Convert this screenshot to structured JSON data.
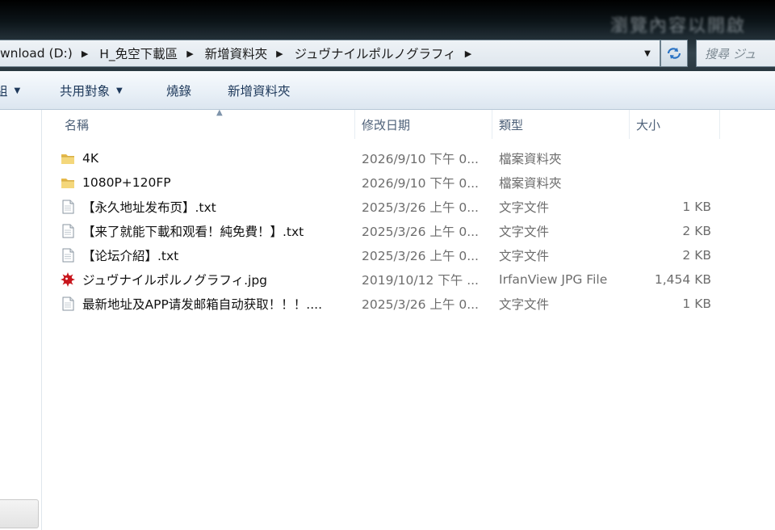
{
  "window": {
    "title_blurred": "瀏覽內容以開啟"
  },
  "address": {
    "crumbs": [
      "wnload (D:)",
      "H_免空下載區",
      "新增資料夾",
      "ジュヴナイルポルノグラフィ"
    ],
    "search_placeholder": "搜尋 ジュ"
  },
  "toolbar": {
    "organize_label": "組",
    "share_label": "共用對象",
    "burn_label": "燒錄",
    "new_folder_label": "新增資料夾"
  },
  "columns": {
    "name": "名稱",
    "date": "修改日期",
    "type": "類型",
    "size": "大小"
  },
  "files": [
    {
      "name": "4K",
      "date": "2026/9/10 下午 0...",
      "type": "檔案資料夾",
      "size": "",
      "icon": "folder-icon"
    },
    {
      "name": "1080P+120FP",
      "date": "2026/9/10 下午 0...",
      "type": "檔案資料夾",
      "size": "",
      "icon": "folder-icon"
    },
    {
      "name": "【永久地址发布页】.txt",
      "date": "2025/3/26 上午 0...",
      "type": "文字文件",
      "size": "1 KB",
      "icon": "text-file-icon"
    },
    {
      "name": "【来了就能下載和观看！純免費！】.txt",
      "date": "2025/3/26 上午 0...",
      "type": "文字文件",
      "size": "2 KB",
      "icon": "text-file-icon"
    },
    {
      "name": "【论坛介紹】.txt",
      "date": "2025/3/26 上午 0...",
      "type": "文字文件",
      "size": "2 KB",
      "icon": "text-file-icon"
    },
    {
      "name": "ジュヴナイルポルノグラフィ.jpg",
      "date": "2019/10/12 下午 ...",
      "type": "IrfanView JPG File",
      "size": "1,454 KB",
      "icon": "irfanview-image-icon"
    },
    {
      "name": "最新地址及APP请发邮箱自动获取！！！....",
      "date": "2025/3/26 上午 0...",
      "type": "文字文件",
      "size": "1 KB",
      "icon": "text-file-icon"
    }
  ]
}
